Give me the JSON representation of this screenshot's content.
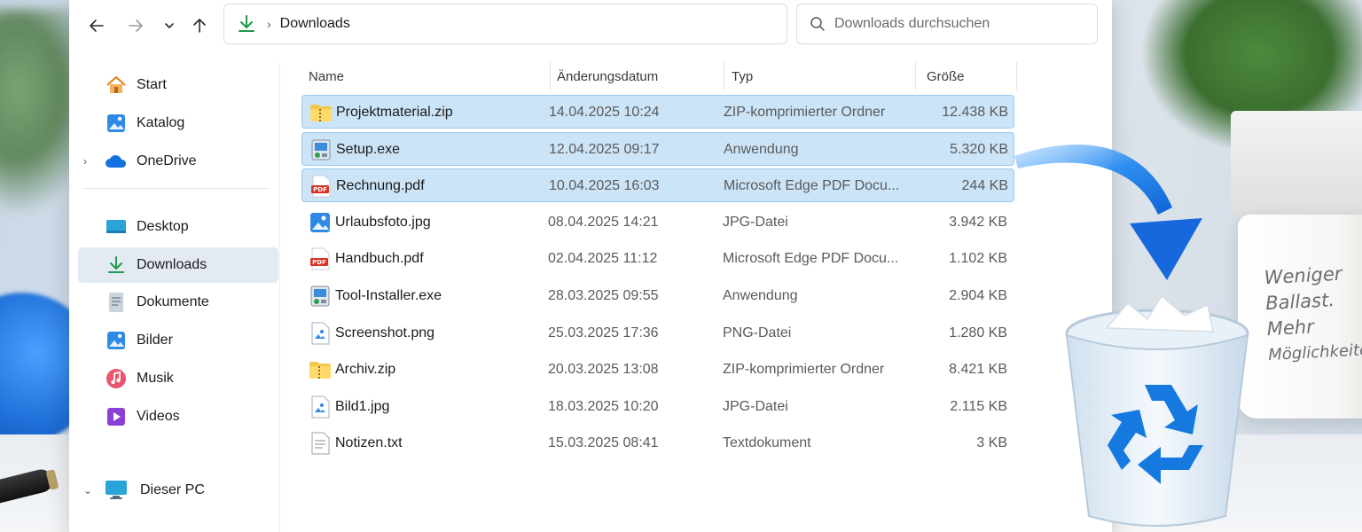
{
  "address": {
    "crumb": "Downloads",
    "location_icon": "download-arrow-icon"
  },
  "search": {
    "placeholder": "Downloads durchsuchen"
  },
  "sidebar": {
    "items": [
      {
        "label": "Start",
        "icon": "home-icon"
      },
      {
        "label": "Katalog",
        "icon": "gallery-icon"
      },
      {
        "label": "OneDrive",
        "icon": "cloud-icon"
      },
      {
        "label": "Desktop",
        "icon": "desktop-icon"
      },
      {
        "label": "Downloads",
        "icon": "download-icon",
        "active": true
      },
      {
        "label": "Dokumente",
        "icon": "documents-icon"
      },
      {
        "label": "Bilder",
        "icon": "pictures-icon"
      },
      {
        "label": "Musik",
        "icon": "music-icon"
      },
      {
        "label": "Videos",
        "icon": "videos-icon"
      },
      {
        "label": "Dieser PC",
        "icon": "computer-icon"
      }
    ]
  },
  "table": {
    "columns": {
      "name": "Name",
      "date": "Änderungsdatum",
      "type": "Typ",
      "size": "Größe"
    },
    "rows": [
      {
        "name": "Projektmaterial.zip",
        "date": "14.04.2025 10:24",
        "type": "ZIP-komprimierter Ordner",
        "size": "12.438 KB",
        "icon": "zip-folder-icon",
        "selected": true
      },
      {
        "name": "Setup.exe",
        "date": "12.04.2025 09:17",
        "type": "Anwendung",
        "size": "5.320 KB",
        "icon": "installer-icon",
        "selected": true
      },
      {
        "name": "Rechnung.pdf",
        "date": "10.04.2025 16:03",
        "type": "Microsoft Edge PDF Docu...",
        "size": "244 KB",
        "icon": "pdf-icon",
        "selected": true
      },
      {
        "name": "Urlaubsfoto.jpg",
        "date": "08.04.2025 14:21",
        "type": "JPG-Datei",
        "size": "3.942 KB",
        "icon": "image-icon",
        "selected": false
      },
      {
        "name": "Handbuch.pdf",
        "date": "02.04.2025 11:12",
        "type": "Microsoft Edge PDF Docu...",
        "size": "1.102 KB",
        "icon": "pdf-icon",
        "selected": false
      },
      {
        "name": "Tool-Installer.exe",
        "date": "28.03.2025 09:55",
        "type": "Anwendung",
        "size": "2.904 KB",
        "icon": "installer-icon",
        "selected": false
      },
      {
        "name": "Screenshot.png",
        "date": "25.03.2025 17:36",
        "type": "PNG-Datei",
        "size": "1.280 KB",
        "icon": "image-file-icon",
        "selected": false
      },
      {
        "name": "Archiv.zip",
        "date": "20.03.2025 13:08",
        "type": "ZIP-komprimierter Ordner",
        "size": "8.421 KB",
        "icon": "zip-folder-icon",
        "selected": false
      },
      {
        "name": "Bild1.jpg",
        "date": "18.03.2025 10:20",
        "type": "JPG-Datei",
        "size": "2.115 KB",
        "icon": "image-file-icon",
        "selected": false
      },
      {
        "name": "Notizen.txt",
        "date": "15.03.2025 08:41",
        "type": "Textdokument",
        "size": "3 KB",
        "icon": "text-file-icon",
        "selected": false
      }
    ]
  },
  "mug": {
    "lines": [
      "Weniger",
      "Ballast.",
      "Mehr",
      "Möglichkeiten."
    ]
  },
  "colors": {
    "selection": "#cce4f7",
    "accent": "#0f7be6",
    "recycle": "#1679e0"
  }
}
